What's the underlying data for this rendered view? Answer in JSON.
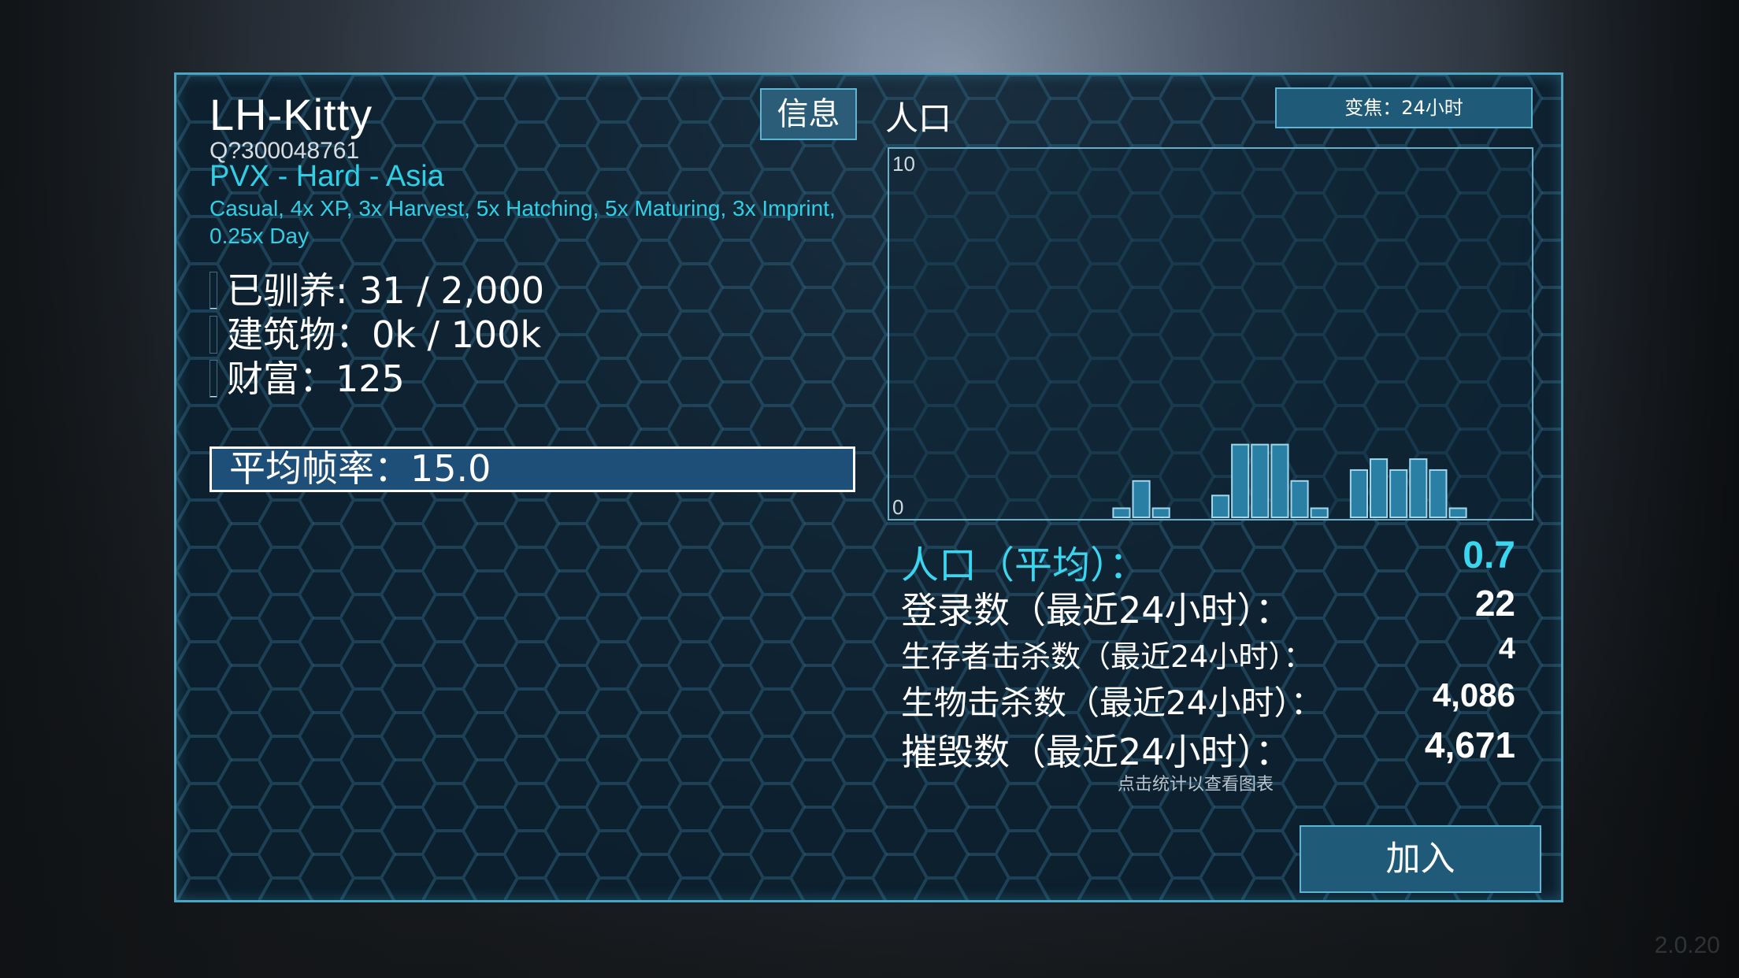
{
  "server": {
    "name": "LH-Kitty",
    "id": "Q?300048761",
    "mode": "PVX - Hard - Asia",
    "rules": "Casual, 4x XP, 3x Harvest, 5x Hatching, 5x Maturing, 3x Imprint, 0.25x Day"
  },
  "stats": [
    {
      "label": "已驯养: 31 / 2,000",
      "fill": 0.0155
    },
    {
      "label": "建筑物：0k / 100k",
      "fill": 0.0
    },
    {
      "label": "财富：125",
      "fill": 0.02
    },
    {
      "label": "平均帧率：15.0",
      "fill": 0.5,
      "selected": true
    }
  ],
  "tabs": {
    "info": "信息",
    "population": "人口"
  },
  "zoom_button": "变焦：24小时",
  "chart_data": {
    "type": "bar",
    "ylim": [
      0,
      10
    ],
    "y_ticks": [
      "10",
      "0"
    ],
    "bar_color": "#2a7fa4",
    "values": [
      0,
      0,
      0,
      0,
      0,
      0,
      0,
      0,
      0,
      0,
      0,
      0.25,
      1.0,
      0.25,
      0,
      0,
      0.6,
      2.0,
      2.0,
      2.0,
      1.0,
      0.25,
      0,
      1.3,
      1.6,
      1.3,
      1.6,
      1.3,
      0.25,
      0,
      0,
      0
    ]
  },
  "pop_stats": [
    {
      "label": "人口（平均）：",
      "value": "0.7",
      "color": "#3ad6ef"
    },
    {
      "label": "登录数（最近24小时）：",
      "value": "22",
      "color": "#ffffff"
    },
    {
      "label": "生存者击杀数（最近24小时）：",
      "value": "4",
      "color": "#ffffff"
    },
    {
      "label": "生物击杀数（最近24小时）：",
      "value": "4,086",
      "color": "#ffffff"
    },
    {
      "label": "摧毁数（最近24小时）：",
      "value": "4,671",
      "color": "#ffffff"
    }
  ],
  "hint": "点击统计以查看图表",
  "join_button": "加入",
  "version": "2.0.20"
}
